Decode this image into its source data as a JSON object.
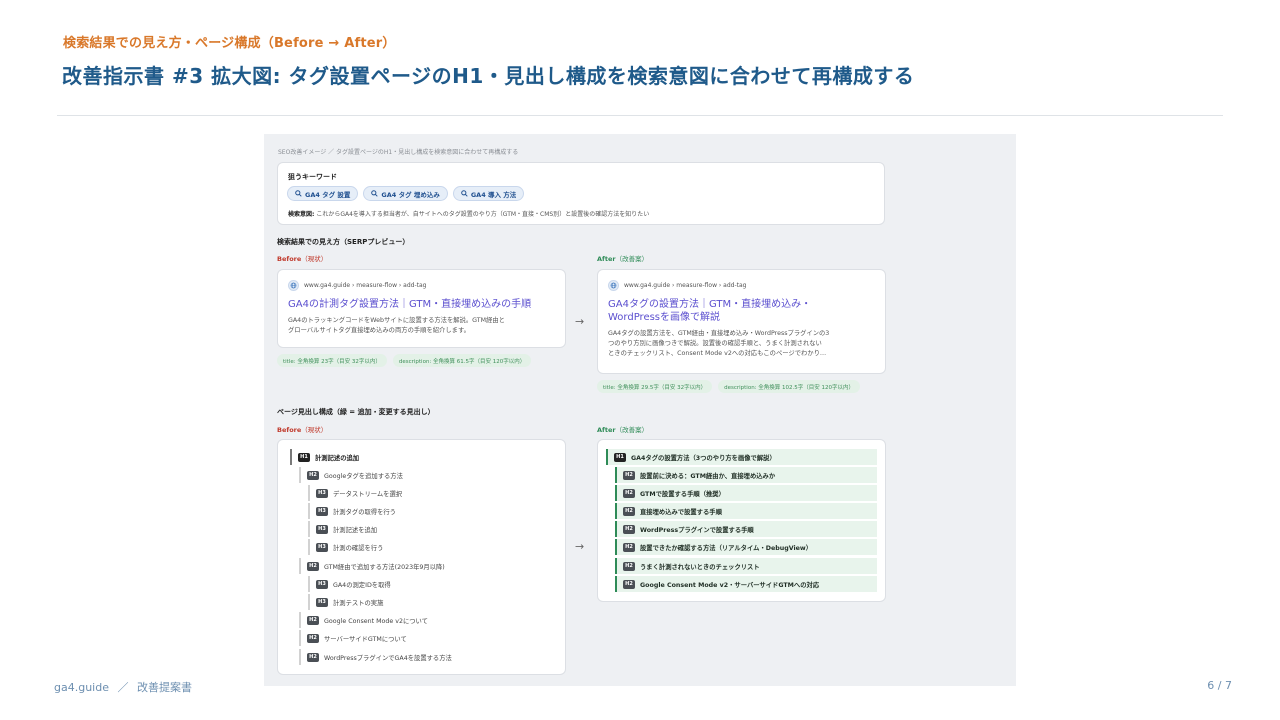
{
  "header": {
    "eyebrow": "検索結果での見え方・ページ構成（Before → After）",
    "title": "改善指示書 #3 拡大図: タグ設置ページのH1・見出し構成を検索意図に合わせて再構成する"
  },
  "panel": {
    "breadcrumb": "SEO改善イメージ ／ タグ設置ページのH1・見出し構成を検索意図に合わせて再構成する",
    "keywords": {
      "label": "狙うキーワード",
      "chips": [
        "GA4 タグ 設置",
        "GA4 タグ 埋め込み",
        "GA4 導入 方法"
      ],
      "intent_label": "検索意図:",
      "intent_text": " これからGA4を導入する担当者が、自サイトへのタグ設置のやり方（GTM・直接・CMS別）と設置後の確認方法を知りたい"
    },
    "serp": {
      "heading": "検索結果での見え方（SERPプレビュー）",
      "before_label": "Before",
      "before_sub": "（現状）",
      "after_label": "After",
      "after_sub": "（改善案）",
      "before": {
        "url": "www.ga4.guide › measure-flow › add-tag",
        "title": "GA4の計測タグ設置方法｜GTM・直接埋め込みの手順",
        "desc_1": "GA4のトラッキングコードをWebサイトに設置する方法を解説。GTM経由と",
        "desc_2": "グローバルサイトタグ直接埋め込みの両方の手順を紹介します。",
        "badge_title": "title: 全角換算 23字（目安 32字以内）",
        "badge_desc": "description: 全角換算 61.5字（目安 120字以内）"
      },
      "after": {
        "url": "www.ga4.guide › measure-flow › add-tag",
        "title_1": "GA4タグの設置方法｜GTM・直接埋め込み・",
        "title_2": "WordPressを画像で解説",
        "desc_1": "GA4タグの設置方法を、GTM経由・直接埋め込み・WordPressプラグインの3",
        "desc_2": "つのやり方別に画像つきで解説。設置後の確認手順と、うまく計測されない",
        "desc_3": "ときのチェックリスト、Consent Mode v2への対応もこのページでわかり…",
        "badge_title": "title: 全角換算 29.5字（目安 32字以内）",
        "badge_desc": "description: 全角換算 102.5字（目安 120字以内）"
      },
      "arrow": "→"
    },
    "headings": {
      "heading": "ページ見出し構成（緑 = 追加・変更する見出し）",
      "before_label": "Before",
      "before_sub": "（現状）",
      "after_label": "After",
      "after_sub": "（改善案）",
      "arrow": "→",
      "before": [
        {
          "level": "H1",
          "text": "計測記述の追加"
        },
        {
          "level": "H2",
          "text": "Googleタグを追加する方法"
        },
        {
          "level": "H3",
          "text": "データストリームを選択"
        },
        {
          "level": "H3",
          "text": "計測タグの取得を行う"
        },
        {
          "level": "H3",
          "text": "計測記述を追加"
        },
        {
          "level": "H3",
          "text": "計測の確認を行う"
        },
        {
          "level": "H2",
          "text": "GTM経由で追加する方法(2023年9月以降)"
        },
        {
          "level": "H3",
          "text": "GA4の測定IDを取得"
        },
        {
          "level": "H3",
          "text": "計測テストの実施"
        },
        {
          "level": "H2",
          "text": "Google Consent Mode v2について"
        },
        {
          "level": "H2",
          "text": "サーバーサイドGTMについて"
        },
        {
          "level": "H2",
          "text": "WordPressプラグインでGA4を設置する方法"
        }
      ],
      "after": [
        {
          "level": "H1",
          "text": "GA4タグの設置方法（3つのやり方を画像で解説）"
        },
        {
          "level": "H2",
          "text": "設置前に決める：GTM経由か、直接埋め込みか"
        },
        {
          "level": "H2",
          "text": "GTMで設置する手順（推奨）"
        },
        {
          "level": "H2",
          "text": "直接埋め込みで設置する手順"
        },
        {
          "level": "H2",
          "text": "WordPressプラグインで設置する手順"
        },
        {
          "level": "H2",
          "text": "設置できたか確認する方法（リアルタイム・DebugView）"
        },
        {
          "level": "H2",
          "text": "うまく計測されないときのチェックリスト"
        },
        {
          "level": "H2",
          "text": "Google Consent Mode v2・サーバーサイドGTMへの対応"
        }
      ]
    }
  },
  "footer": {
    "site": "ga4.guide",
    "sep": "／",
    "doc": "改善提案書",
    "page": "6 / 7"
  },
  "colors": {
    "accent_orange": "#d9782a",
    "title_blue": "#1f5a8a",
    "before_red": "#c0392b",
    "after_green": "#2e8b57",
    "serp_link": "#5b4fcf"
  }
}
